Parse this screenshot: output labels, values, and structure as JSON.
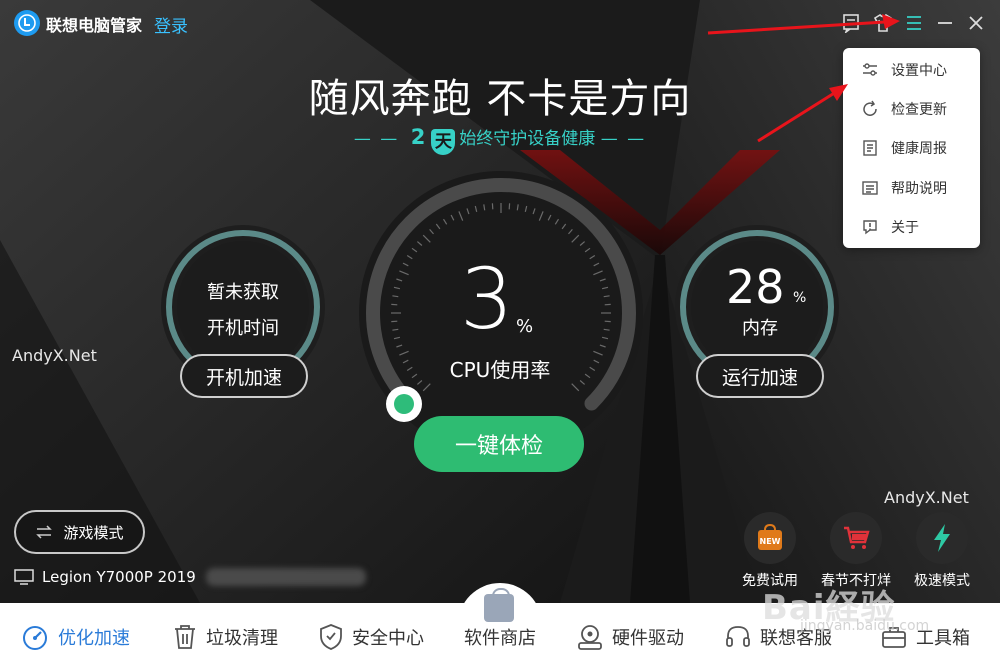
{
  "app": {
    "title": "联想电脑管家",
    "login_label": "登录"
  },
  "titlebar_icons": [
    "feedback-icon",
    "skin-icon",
    "menu-icon",
    "minimize-icon",
    "close-icon"
  ],
  "headline": "随风奔跑 不卡是方向",
  "subline": {
    "days": "2",
    "badge": "天",
    "text": "始终守护设备健康",
    "dash_left": "— —",
    "dash_right": "— —"
  },
  "boot_gauge": {
    "line1": "暂未获取",
    "line2": "开机时间",
    "button": "开机加速"
  },
  "cpu_gauge": {
    "value": "3",
    "unit": "%",
    "label": "CPU使用率",
    "level": 0.03
  },
  "memory_gauge": {
    "value": "28",
    "unit": "%",
    "label": "内存",
    "button": "运行加速",
    "level": 0.28
  },
  "checkup_button": "一键体检",
  "watermark": "AndyX.Net",
  "game_mode": "游戏模式",
  "device_name": "Legion Y7000P 2019",
  "promos": [
    {
      "label": "免费试用",
      "badge": "NEW",
      "icon": "gift-icon",
      "color": "#e07a1a"
    },
    {
      "label": "春节不打烊",
      "icon": "cart-icon",
      "color": "#e0323a"
    },
    {
      "label": "极速模式",
      "icon": "lightning-icon",
      "color": "#2ec9a4"
    }
  ],
  "nav": [
    {
      "label": "优化加速",
      "icon": "speed-icon",
      "active": true
    },
    {
      "label": "垃圾清理",
      "icon": "trash-icon"
    },
    {
      "label": "安全中心",
      "icon": "shield-icon"
    },
    {
      "label": "软件商店",
      "icon": "store-icon"
    },
    {
      "label": "硬件驱动",
      "icon": "driver-icon"
    },
    {
      "label": "联想客服",
      "icon": "headset-icon"
    },
    {
      "label": "工具箱",
      "icon": "toolbox-icon"
    }
  ],
  "menu": [
    {
      "label": "设置中心",
      "icon": "settings-icon"
    },
    {
      "label": "检查更新",
      "icon": "refresh-icon"
    },
    {
      "label": "健康周报",
      "icon": "report-icon"
    },
    {
      "label": "帮助说明",
      "icon": "help-icon"
    },
    {
      "label": "关于",
      "icon": "info-icon"
    }
  ],
  "colors": {
    "accent_green": "#2ebc72",
    "accent_teal": "#37d1c7",
    "link_blue": "#39c1ff",
    "nav_active": "#2a7bd8",
    "arrow_red": "#e8141b"
  },
  "baidu_watermark": {
    "text": "Bai経验",
    "sub": "jingyan.baidu.com"
  }
}
